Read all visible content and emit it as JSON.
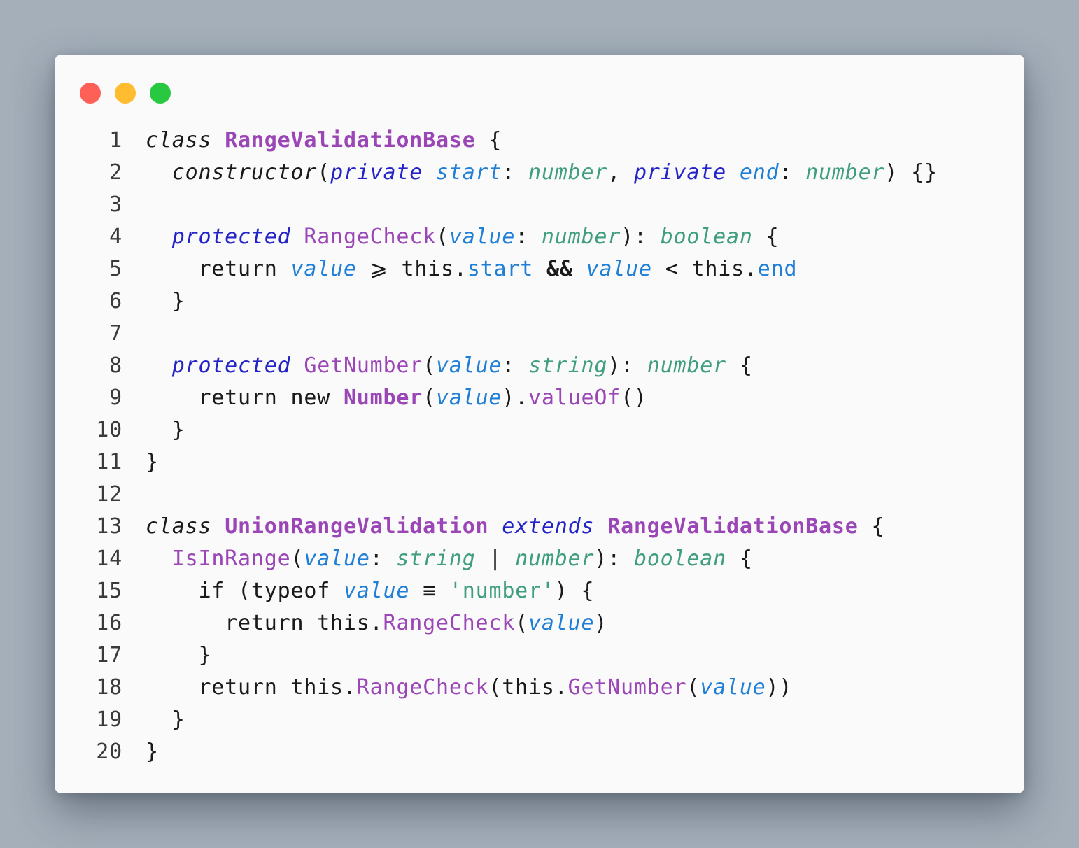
{
  "window": {
    "controls": [
      {
        "name": "close",
        "color": "#fe5f57"
      },
      {
        "name": "minimize",
        "color": "#febc2e"
      },
      {
        "name": "maximize",
        "color": "#28c840"
      }
    ]
  },
  "code": {
    "language": "typescript",
    "lines": [
      {
        "number": "1",
        "tokens": [
          {
            "t": "class",
            "k": "kw"
          },
          {
            "t": " ",
            "k": "plain"
          },
          {
            "t": "RangeValidationBase",
            "k": "cls"
          },
          {
            "t": " {",
            "k": "plain"
          }
        ]
      },
      {
        "number": "2",
        "tokens": [
          {
            "t": "  ",
            "k": "plain"
          },
          {
            "t": "constructor",
            "k": "kw"
          },
          {
            "t": "(",
            "k": "plain"
          },
          {
            "t": "private",
            "k": "mod"
          },
          {
            "t": " ",
            "k": "plain"
          },
          {
            "t": "start",
            "k": "param"
          },
          {
            "t": ": ",
            "k": "plain"
          },
          {
            "t": "number",
            "k": "type"
          },
          {
            "t": ", ",
            "k": "plain"
          },
          {
            "t": "private",
            "k": "mod"
          },
          {
            "t": " ",
            "k": "plain"
          },
          {
            "t": "end",
            "k": "param"
          },
          {
            "t": ": ",
            "k": "plain"
          },
          {
            "t": "number",
            "k": "type"
          },
          {
            "t": ") {}",
            "k": "plain"
          }
        ]
      },
      {
        "number": "3",
        "tokens": []
      },
      {
        "number": "4",
        "tokens": [
          {
            "t": "  ",
            "k": "plain"
          },
          {
            "t": "protected",
            "k": "mod"
          },
          {
            "t": " ",
            "k": "plain"
          },
          {
            "t": "RangeCheck",
            "k": "func"
          },
          {
            "t": "(",
            "k": "plain"
          },
          {
            "t": "value",
            "k": "param"
          },
          {
            "t": ": ",
            "k": "plain"
          },
          {
            "t": "number",
            "k": "type"
          },
          {
            "t": "): ",
            "k": "plain"
          },
          {
            "t": "boolean",
            "k": "type"
          },
          {
            "t": " {",
            "k": "plain"
          }
        ]
      },
      {
        "number": "5",
        "tokens": [
          {
            "t": "    return ",
            "k": "plain"
          },
          {
            "t": "value",
            "k": "param"
          },
          {
            "t": " ",
            "k": "plain"
          },
          {
            "t": "⩾",
            "k": "op"
          },
          {
            "t": " this.",
            "k": "plain"
          },
          {
            "t": "start",
            "k": "prop"
          },
          {
            "t": " ",
            "k": "plain"
          },
          {
            "t": "&&",
            "k": "opb"
          },
          {
            "t": " ",
            "k": "plain"
          },
          {
            "t": "value",
            "k": "param"
          },
          {
            "t": " < this.",
            "k": "plain"
          },
          {
            "t": "end",
            "k": "prop"
          }
        ]
      },
      {
        "number": "6",
        "tokens": [
          {
            "t": "  }",
            "k": "plain"
          }
        ]
      },
      {
        "number": "7",
        "tokens": []
      },
      {
        "number": "8",
        "tokens": [
          {
            "t": "  ",
            "k": "plain"
          },
          {
            "t": "protected",
            "k": "mod"
          },
          {
            "t": " ",
            "k": "plain"
          },
          {
            "t": "GetNumber",
            "k": "func"
          },
          {
            "t": "(",
            "k": "plain"
          },
          {
            "t": "value",
            "k": "param"
          },
          {
            "t": ": ",
            "k": "plain"
          },
          {
            "t": "string",
            "k": "type"
          },
          {
            "t": "): ",
            "k": "plain"
          },
          {
            "t": "number",
            "k": "type"
          },
          {
            "t": " {",
            "k": "plain"
          }
        ]
      },
      {
        "number": "9",
        "tokens": [
          {
            "t": "    return new ",
            "k": "plain"
          },
          {
            "t": "Number",
            "k": "cls"
          },
          {
            "t": "(",
            "k": "plain"
          },
          {
            "t": "value",
            "k": "param"
          },
          {
            "t": ").",
            "k": "plain"
          },
          {
            "t": "valueOf",
            "k": "func"
          },
          {
            "t": "()",
            "k": "plain"
          }
        ]
      },
      {
        "number": "10",
        "tokens": [
          {
            "t": "  }",
            "k": "plain"
          }
        ]
      },
      {
        "number": "11",
        "tokens": [
          {
            "t": "}",
            "k": "plain"
          }
        ]
      },
      {
        "number": "12",
        "tokens": []
      },
      {
        "number": "13",
        "tokens": [
          {
            "t": "class",
            "k": "kw"
          },
          {
            "t": " ",
            "k": "plain"
          },
          {
            "t": "UnionRangeValidation",
            "k": "cls"
          },
          {
            "t": " ",
            "k": "plain"
          },
          {
            "t": "extends",
            "k": "mod"
          },
          {
            "t": " ",
            "k": "plain"
          },
          {
            "t": "RangeValidationBase",
            "k": "cls"
          },
          {
            "t": " {",
            "k": "plain"
          }
        ]
      },
      {
        "number": "14",
        "tokens": [
          {
            "t": "  ",
            "k": "plain"
          },
          {
            "t": "IsInRange",
            "k": "func"
          },
          {
            "t": "(",
            "k": "plain"
          },
          {
            "t": "value",
            "k": "param"
          },
          {
            "t": ": ",
            "k": "plain"
          },
          {
            "t": "string",
            "k": "type"
          },
          {
            "t": " | ",
            "k": "plain"
          },
          {
            "t": "number",
            "k": "type"
          },
          {
            "t": "): ",
            "k": "plain"
          },
          {
            "t": "boolean",
            "k": "type"
          },
          {
            "t": " {",
            "k": "plain"
          }
        ]
      },
      {
        "number": "15",
        "tokens": [
          {
            "t": "    if (typeof ",
            "k": "plain"
          },
          {
            "t": "value",
            "k": "param"
          },
          {
            "t": " ",
            "k": "plain"
          },
          {
            "t": "≡",
            "k": "op"
          },
          {
            "t": " ",
            "k": "plain"
          },
          {
            "t": "'number'",
            "k": "str"
          },
          {
            "t": ") {",
            "k": "plain"
          }
        ]
      },
      {
        "number": "16",
        "tokens": [
          {
            "t": "      return this.",
            "k": "plain"
          },
          {
            "t": "RangeCheck",
            "k": "func"
          },
          {
            "t": "(",
            "k": "plain"
          },
          {
            "t": "value",
            "k": "param"
          },
          {
            "t": ")",
            "k": "plain"
          }
        ]
      },
      {
        "number": "17",
        "tokens": [
          {
            "t": "    }",
            "k": "plain"
          }
        ]
      },
      {
        "number": "18",
        "tokens": [
          {
            "t": "    return this.",
            "k": "plain"
          },
          {
            "t": "RangeCheck",
            "k": "func"
          },
          {
            "t": "(this.",
            "k": "plain"
          },
          {
            "t": "GetNumber",
            "k": "func"
          },
          {
            "t": "(",
            "k": "plain"
          },
          {
            "t": "value",
            "k": "param"
          },
          {
            "t": "))",
            "k": "plain"
          }
        ]
      },
      {
        "number": "19",
        "tokens": [
          {
            "t": "  }",
            "k": "plain"
          }
        ]
      },
      {
        "number": "20",
        "tokens": [
          {
            "t": "}",
            "k": "plain"
          }
        ]
      }
    ]
  }
}
